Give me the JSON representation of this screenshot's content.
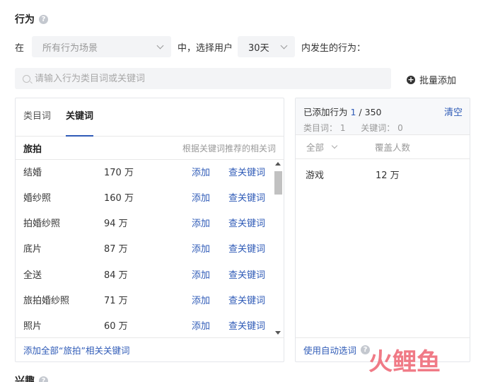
{
  "behavior": {
    "title": "行为",
    "prefix": "在",
    "scene_placeholder": "所有行为场景",
    "middle": "中，选择用户",
    "days_value": "30天",
    "suffix": "内发生的行为："
  },
  "search": {
    "placeholder": "请输入行为类目词或关键词"
  },
  "batch_add_label": "批量添加",
  "left_panel": {
    "tabs": [
      {
        "label": "类目词",
        "active": false
      },
      {
        "label": "关键词",
        "active": true
      }
    ],
    "keyword": "旅拍",
    "hint": "根据关键词推荐的相关词",
    "add_label": "添加",
    "lookup_label": "查关键词",
    "rows": [
      {
        "name": "结婚",
        "count": "170 万"
      },
      {
        "name": "婚纱照",
        "count": "160 万"
      },
      {
        "name": "拍婚纱照",
        "count": "94 万"
      },
      {
        "name": "底片",
        "count": "87 万"
      },
      {
        "name": "全送",
        "count": "84 万"
      },
      {
        "name": "旅拍婚纱照",
        "count": "71 万"
      },
      {
        "name": "照片",
        "count": "60 万"
      }
    ],
    "footer": "添加全部“旅拍”相关关键词"
  },
  "right_panel": {
    "added_prefix": "已添加行为",
    "added_count": "1",
    "added_total": " / 350",
    "clear_label": "清空",
    "category_count": "类目词： 1",
    "keyword_count": "关键词： 0",
    "filter_label": "全部",
    "cover_label": "覆盖人数",
    "rows": [
      {
        "name": "游戏",
        "count": "12 万"
      }
    ],
    "footer": "使用自动选词"
  },
  "next_section_title": "兴趣",
  "watermark": "火鲤鱼",
  "colors": {
    "link": "#2f5bb7",
    "panel_border": "#e4e6ea",
    "input_bg": "#f3f4f6"
  }
}
